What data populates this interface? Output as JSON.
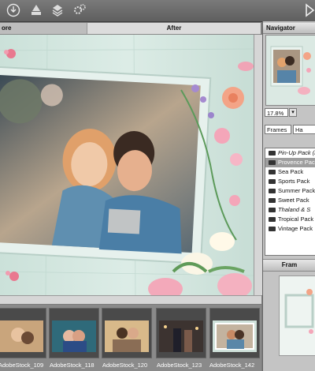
{
  "toolbar": {
    "icons": [
      "download-icon",
      "stamp-icon",
      "layers-icon",
      "settings-icon",
      "play-icon"
    ]
  },
  "tabs": {
    "before": "ore",
    "after": "After"
  },
  "navigator": {
    "title": "Navigator",
    "zoom": "17.8%"
  },
  "selectors": {
    "category": "Frames",
    "second": "Ha"
  },
  "packs": [
    {
      "label": "Pin-Up Pack (i",
      "italic": true
    },
    {
      "label": "Provence Pack",
      "active": true
    },
    {
      "label": "Sea Pack"
    },
    {
      "label": "Sports Pack"
    },
    {
      "label": "Summer Pack"
    },
    {
      "label": "Sweet Pack"
    },
    {
      "label": "Thaland & S",
      "italic": true
    },
    {
      "label": "Tropical Pack"
    },
    {
      "label": "Vintage Pack"
    }
  ],
  "frames_panel": {
    "title": "Fram"
  },
  "filmstrip": [
    {
      "label": "AdobeStock_109"
    },
    {
      "label": "AdobeStock_118"
    },
    {
      "label": "AdobeStock_120"
    },
    {
      "label": "AdobeStock_123"
    },
    {
      "label": "AdobeStock_142"
    }
  ],
  "colors": {
    "frame": "#d9ece6",
    "wood": "#cfe3dc",
    "accent_pink": "#f08aa5",
    "list_active": "#9e9e9e"
  }
}
